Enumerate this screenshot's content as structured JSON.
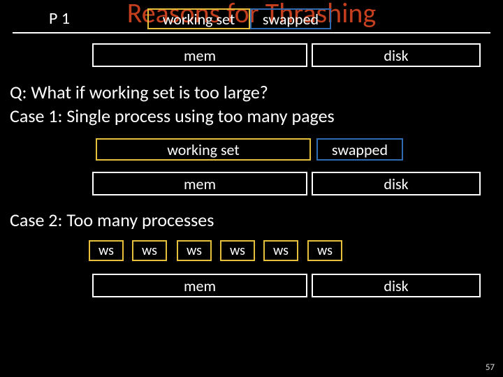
{
  "title": "Reasons for Thrashing",
  "p_label": "P 1",
  "working_set": "working set",
  "swapped": "swapped",
  "mem": "mem",
  "disk": "disk",
  "q_line": "Q: What if working set is too large?",
  "case1": "Case 1: Single process using too many pages",
  "case2": "Case 2: Too many processes",
  "ws_short": "ws",
  "slide_number": "57"
}
